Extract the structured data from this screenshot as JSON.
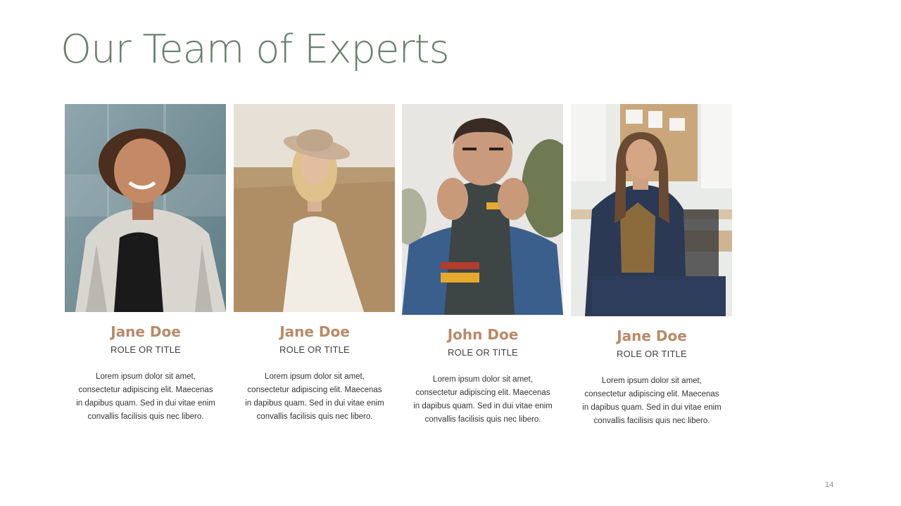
{
  "slide": {
    "title": "Our Team of Experts",
    "page_number": "14",
    "colors": {
      "title": "#6b7f71",
      "name": "#b88a68",
      "text": "#333333"
    }
  },
  "team": [
    {
      "name": "Jane Doe",
      "role": "ROLE OR TITLE",
      "bio": "Lorem ipsum dolor sit amet, consectetur adipiscing elit. Maecenas in dapibus quam. Sed in dui vitae enim convallis facilisis quis nec libero."
    },
    {
      "name": "Jane Doe",
      "role": "ROLE OR TITLE",
      "bio": "Lorem ipsum dolor sit amet, consectetur adipiscing elit. Maecenas in dapibus quam. Sed in dui vitae enim convallis facilisis quis nec libero."
    },
    {
      "name": "John Doe",
      "role": "ROLE OR TITLE",
      "bio": "Lorem ipsum dolor sit amet, consectetur adipiscing elit. Maecenas in dapibus quam. Sed in dui vitae enim convallis facilisis quis nec libero."
    },
    {
      "name": "Jane Doe",
      "role": "ROLE OR TITLE",
      "bio": "Lorem ipsum dolor sit amet, consectetur adipiscing elit. Maecenas in dapibus quam. Sed in dui vitae enim convallis facilisis quis nec libero."
    }
  ]
}
